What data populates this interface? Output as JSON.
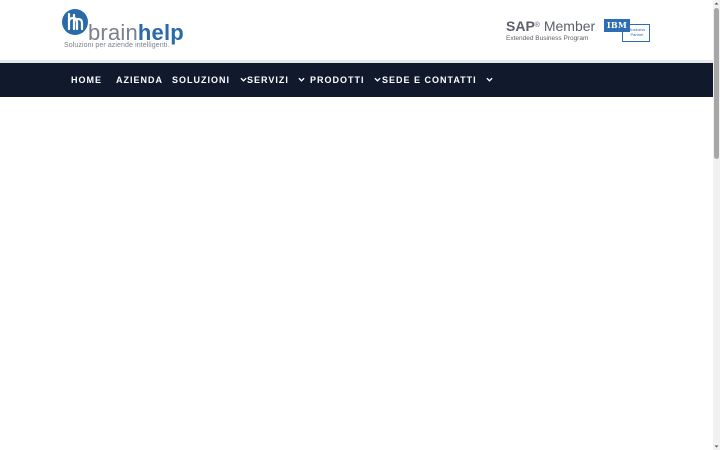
{
  "header": {
    "logo": {
      "name_part1": "brain",
      "name_part2": "help",
      "tagline": "Soluzioni per aziende intelligenti."
    },
    "partners": {
      "sap_brand": "SAP",
      "sap_reg": "®",
      "sap_member": "Member",
      "sap_program": "Extended Business Program",
      "ibm_brand": "IBM",
      "ibm_partner": "Business Partner"
    }
  },
  "nav": {
    "items": [
      {
        "label": "HOME",
        "has_dropdown": false
      },
      {
        "label": "AZIENDA",
        "has_dropdown": false
      },
      {
        "label": "SOLUZIONI",
        "has_dropdown": true
      },
      {
        "label": "SERVIZI",
        "has_dropdown": true
      },
      {
        "label": "PRODOTTI",
        "has_dropdown": true
      },
      {
        "label": "SEDE E CONTATTI",
        "has_dropdown": true
      }
    ]
  },
  "colors": {
    "nav_background": "#111a2d",
    "brand_blue": "#2b6aa8",
    "brand_gray": "#7c8089"
  },
  "icons": {
    "dropdown": "chevron-down-icon",
    "scroll_up": "arrow-up-icon",
    "scroll_down": "arrow-down-icon"
  }
}
